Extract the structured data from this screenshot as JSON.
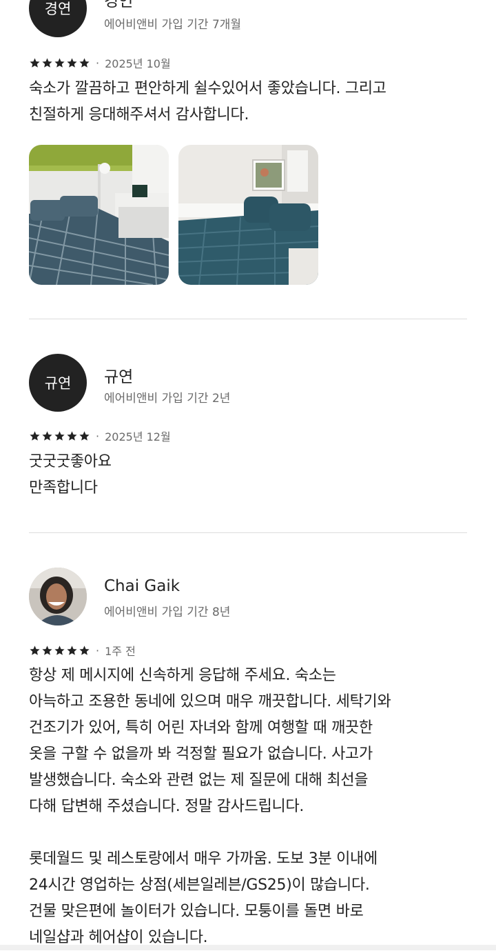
{
  "reviews": [
    {
      "avatar_text": "경연",
      "name": "경연",
      "member_since": "에어비앤비 가입 기간 7개월",
      "rating": 5,
      "date": "2025년 10월",
      "text": "숙소가 깔끔하고 편안하게 쉴수있어서 좋았습니다. 그리고\n친절하게 응대해주셔서 감사합니다.",
      "photos": [
        "bedroom-photo-1",
        "bedroom-photo-2"
      ]
    },
    {
      "avatar_text": "규연",
      "name": "규연",
      "member_since": "에어비앤비 가입 기간 2년",
      "rating": 5,
      "date": "2025년 12월",
      "text": "굿굿굿좋아요\n만족합니다"
    },
    {
      "name": "Chai Gaik",
      "member_since": "에어비앤비 가입 기간 8년",
      "rating": 5,
      "date": "1주 전",
      "text": "항상 제 메시지에 신속하게 응답해 주세요. 숙소는\n아늑하고 조용한 동네에 있으며 매우 깨끗합니다. 세탁기와\n건조기가 있어, 특히 어린 자녀와 함께 여행할 때 깨끗한\n옷을 구할 수 없을까 봐 걱정할 필요가 없습니다. 사고가\n발생했습니다. 숙소와 관련 없는 제 질문에 대해 최선을\n다해 답변해 주셨습니다. 정말 감사드립니다.\n\n롯데월드 및 레스토랑에서 매우 가까움. 도보 3분 이내에\n24시간 영업하는 상점(세븐일레븐/GS25)이 많습니다.\n건물 맞은편에 놀이터가 있습니다. 모퉁이를 돌면 바로\n네일샵과 헤어샵이 있습니다."
    }
  ],
  "colors": {
    "text": "#222222",
    "muted": "#6a6a6a",
    "divider": "#dddddd",
    "avatar_bg": "#222222"
  },
  "icons": {
    "star": "star-icon"
  }
}
